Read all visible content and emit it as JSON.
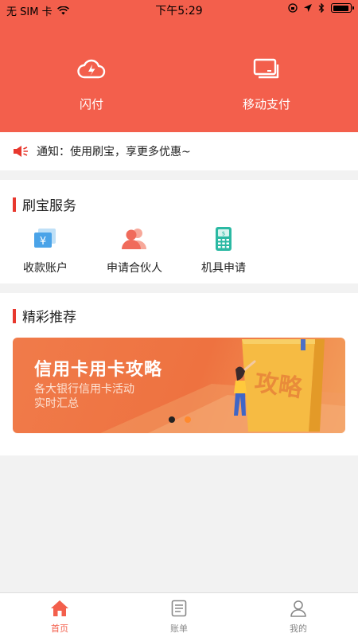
{
  "status_bar": {
    "carrier": "无 SIM 卡",
    "time": "下午5:29"
  },
  "hero": {
    "left_label": "闪付",
    "left_icon": "cloud-lightning-icon",
    "right_label": "移动支付",
    "right_icon": "cards-icon"
  },
  "notice": {
    "icon": "megaphone-icon",
    "text": "通知：使用刷宝，享更多优惠~"
  },
  "services": {
    "title": "刷宝服务",
    "items": [
      {
        "label": "收款账户",
        "icon": "yuan-card-icon"
      },
      {
        "label": "申请合伙人",
        "icon": "partners-icon"
      },
      {
        "label": "机具申请",
        "icon": "pos-terminal-icon"
      }
    ]
  },
  "recommend": {
    "title": "精彩推荐",
    "banner": {
      "title": "信用卡用卡攻略",
      "subtitle_line1": "各大银行信用卡活动",
      "subtitle_line2": "实时汇总",
      "book_text": "攻略"
    }
  },
  "tabbar": {
    "items": [
      {
        "label": "首页",
        "icon": "home-icon",
        "active": true
      },
      {
        "label": "账单",
        "icon": "bill-icon",
        "active": false
      },
      {
        "label": "我的",
        "icon": "user-icon",
        "active": false
      }
    ]
  },
  "colors": {
    "brand": "#f35f4c",
    "accent_bar": "#e8382e",
    "active_tab": "#f35f4c",
    "inactive_tab": "#888888"
  }
}
